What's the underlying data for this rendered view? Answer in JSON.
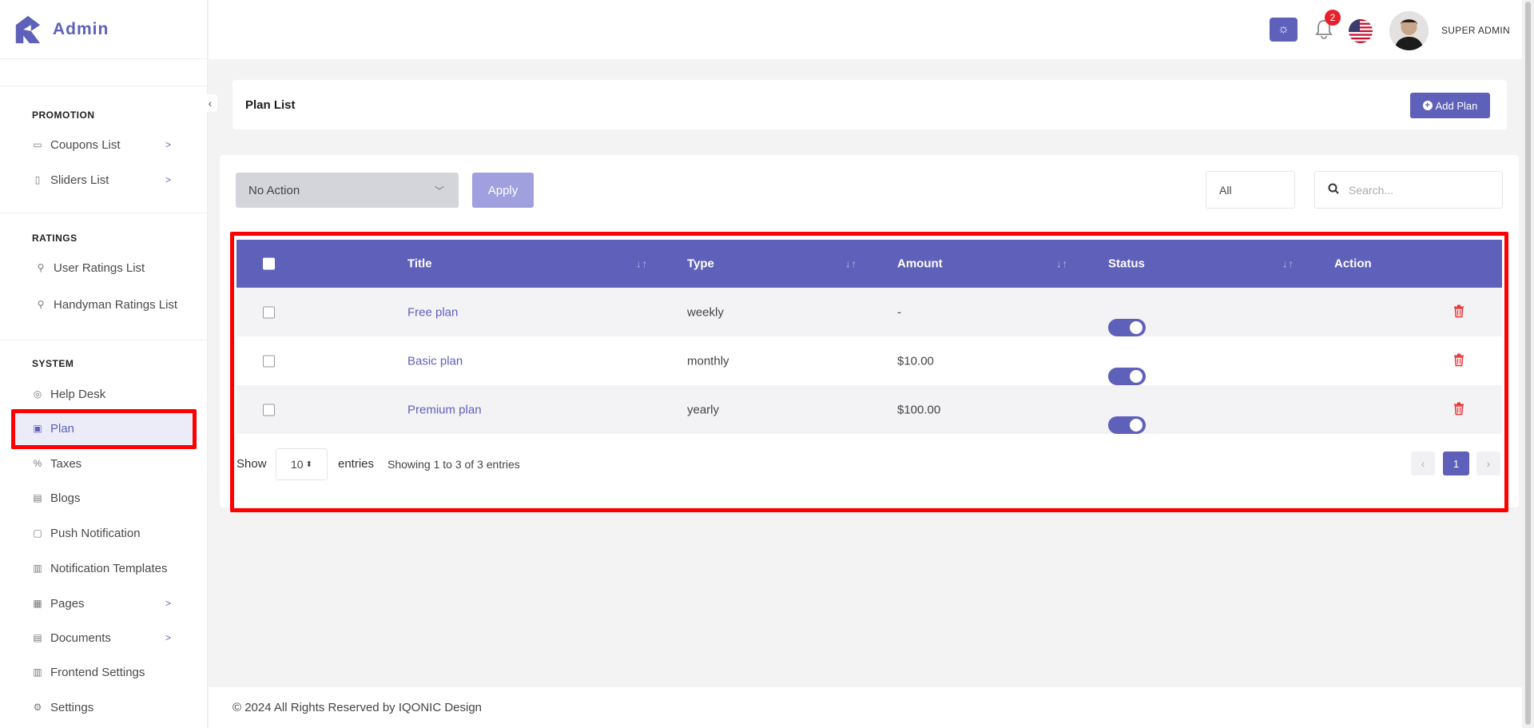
{
  "brand": {
    "name": "Admin",
    "accent": "#5f60b9"
  },
  "header": {
    "user_name": "SUPER ADMIN",
    "notification_count": "2"
  },
  "sidebar": {
    "sections": [
      {
        "title": "PROMOTION",
        "items": [
          {
            "label": "Coupons List",
            "icon": "coupon-icon",
            "has_children": true
          },
          {
            "label": "Sliders List",
            "icon": "slider-icon",
            "has_children": true
          }
        ]
      },
      {
        "title": "RATINGS",
        "items": [
          {
            "label": "User Ratings List",
            "icon": "rating-icon"
          },
          {
            "label": "Handyman Ratings List",
            "icon": "rating-icon"
          }
        ]
      },
      {
        "title": "SYSTEM",
        "items": [
          {
            "label": "Help Desk",
            "icon": "help-desk-icon"
          },
          {
            "label": "Plan",
            "icon": "plan-icon",
            "active": true
          },
          {
            "label": "Taxes",
            "icon": "percent-icon"
          },
          {
            "label": "Blogs",
            "icon": "blog-icon"
          },
          {
            "label": "Push Notification",
            "icon": "push-notification-icon"
          },
          {
            "label": "Notification Templates",
            "icon": "template-icon"
          },
          {
            "label": "Pages",
            "icon": "pages-icon",
            "has_children": true
          },
          {
            "label": "Documents",
            "icon": "documents-icon",
            "has_children": true
          },
          {
            "label": "Frontend Settings",
            "icon": "frontend-settings-icon"
          },
          {
            "label": "Settings",
            "icon": "gear-icon"
          }
        ]
      }
    ]
  },
  "page": {
    "title": "Plan List",
    "add_button": "Add Plan"
  },
  "toolbar": {
    "bulk_action": "No Action",
    "apply_label": "Apply",
    "status_filter": "All",
    "search_placeholder": "Search..."
  },
  "table": {
    "columns": [
      "Title",
      "Type",
      "Amount",
      "Status",
      "Action"
    ],
    "rows": [
      {
        "title": "Free plan",
        "type": "weekly",
        "amount": "-",
        "status": true
      },
      {
        "title": "Basic plan",
        "type": "monthly",
        "amount": "$10.00",
        "status": true
      },
      {
        "title": "Premium plan",
        "type": "yearly",
        "amount": "$100.00",
        "status": true
      }
    ]
  },
  "pagination": {
    "show_label": "Show",
    "page_length": "10",
    "entries_label": "entries",
    "info": "Showing 1 to 3 of 3 entries",
    "current_page": "1"
  },
  "footer": {
    "text": "© 2024 All Rights Reserved by IQONIC Design"
  }
}
